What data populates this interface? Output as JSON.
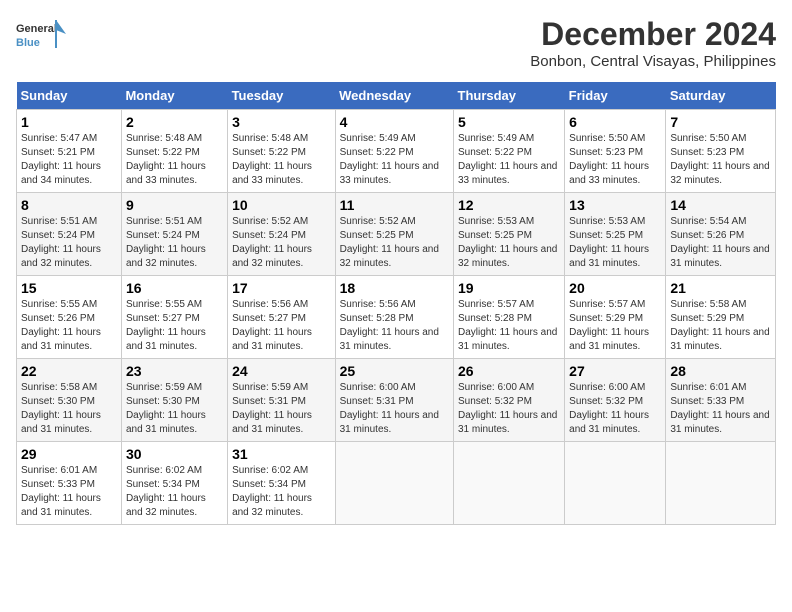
{
  "logo": {
    "line1": "General",
    "line2": "Blue"
  },
  "title": "December 2024",
  "subtitle": "Bonbon, Central Visayas, Philippines",
  "weekdays": [
    "Sunday",
    "Monday",
    "Tuesday",
    "Wednesday",
    "Thursday",
    "Friday",
    "Saturday"
  ],
  "weeks": [
    [
      {
        "day": "1",
        "sunrise": "5:47 AM",
        "sunset": "5:21 PM",
        "daylight": "11 hours and 34 minutes."
      },
      {
        "day": "2",
        "sunrise": "5:48 AM",
        "sunset": "5:22 PM",
        "daylight": "11 hours and 33 minutes."
      },
      {
        "day": "3",
        "sunrise": "5:48 AM",
        "sunset": "5:22 PM",
        "daylight": "11 hours and 33 minutes."
      },
      {
        "day": "4",
        "sunrise": "5:49 AM",
        "sunset": "5:22 PM",
        "daylight": "11 hours and 33 minutes."
      },
      {
        "day": "5",
        "sunrise": "5:49 AM",
        "sunset": "5:22 PM",
        "daylight": "11 hours and 33 minutes."
      },
      {
        "day": "6",
        "sunrise": "5:50 AM",
        "sunset": "5:23 PM",
        "daylight": "11 hours and 33 minutes."
      },
      {
        "day": "7",
        "sunrise": "5:50 AM",
        "sunset": "5:23 PM",
        "daylight": "11 hours and 32 minutes."
      }
    ],
    [
      {
        "day": "8",
        "sunrise": "5:51 AM",
        "sunset": "5:24 PM",
        "daylight": "11 hours and 32 minutes."
      },
      {
        "day": "9",
        "sunrise": "5:51 AM",
        "sunset": "5:24 PM",
        "daylight": "11 hours and 32 minutes."
      },
      {
        "day": "10",
        "sunrise": "5:52 AM",
        "sunset": "5:24 PM",
        "daylight": "11 hours and 32 minutes."
      },
      {
        "day": "11",
        "sunrise": "5:52 AM",
        "sunset": "5:25 PM",
        "daylight": "11 hours and 32 minutes."
      },
      {
        "day": "12",
        "sunrise": "5:53 AM",
        "sunset": "5:25 PM",
        "daylight": "11 hours and 32 minutes."
      },
      {
        "day": "13",
        "sunrise": "5:53 AM",
        "sunset": "5:25 PM",
        "daylight": "11 hours and 31 minutes."
      },
      {
        "day": "14",
        "sunrise": "5:54 AM",
        "sunset": "5:26 PM",
        "daylight": "11 hours and 31 minutes."
      }
    ],
    [
      {
        "day": "15",
        "sunrise": "5:55 AM",
        "sunset": "5:26 PM",
        "daylight": "11 hours and 31 minutes."
      },
      {
        "day": "16",
        "sunrise": "5:55 AM",
        "sunset": "5:27 PM",
        "daylight": "11 hours and 31 minutes."
      },
      {
        "day": "17",
        "sunrise": "5:56 AM",
        "sunset": "5:27 PM",
        "daylight": "11 hours and 31 minutes."
      },
      {
        "day": "18",
        "sunrise": "5:56 AM",
        "sunset": "5:28 PM",
        "daylight": "11 hours and 31 minutes."
      },
      {
        "day": "19",
        "sunrise": "5:57 AM",
        "sunset": "5:28 PM",
        "daylight": "11 hours and 31 minutes."
      },
      {
        "day": "20",
        "sunrise": "5:57 AM",
        "sunset": "5:29 PM",
        "daylight": "11 hours and 31 minutes."
      },
      {
        "day": "21",
        "sunrise": "5:58 AM",
        "sunset": "5:29 PM",
        "daylight": "11 hours and 31 minutes."
      }
    ],
    [
      {
        "day": "22",
        "sunrise": "5:58 AM",
        "sunset": "5:30 PM",
        "daylight": "11 hours and 31 minutes."
      },
      {
        "day": "23",
        "sunrise": "5:59 AM",
        "sunset": "5:30 PM",
        "daylight": "11 hours and 31 minutes."
      },
      {
        "day": "24",
        "sunrise": "5:59 AM",
        "sunset": "5:31 PM",
        "daylight": "11 hours and 31 minutes."
      },
      {
        "day": "25",
        "sunrise": "6:00 AM",
        "sunset": "5:31 PM",
        "daylight": "11 hours and 31 minutes."
      },
      {
        "day": "26",
        "sunrise": "6:00 AM",
        "sunset": "5:32 PM",
        "daylight": "11 hours and 31 minutes."
      },
      {
        "day": "27",
        "sunrise": "6:00 AM",
        "sunset": "5:32 PM",
        "daylight": "11 hours and 31 minutes."
      },
      {
        "day": "28",
        "sunrise": "6:01 AM",
        "sunset": "5:33 PM",
        "daylight": "11 hours and 31 minutes."
      }
    ],
    [
      {
        "day": "29",
        "sunrise": "6:01 AM",
        "sunset": "5:33 PM",
        "daylight": "11 hours and 31 minutes."
      },
      {
        "day": "30",
        "sunrise": "6:02 AM",
        "sunset": "5:34 PM",
        "daylight": "11 hours and 32 minutes."
      },
      {
        "day": "31",
        "sunrise": "6:02 AM",
        "sunset": "5:34 PM",
        "daylight": "11 hours and 32 minutes."
      },
      null,
      null,
      null,
      null
    ]
  ],
  "labels": {
    "sunrise": "Sunrise:",
    "sunset": "Sunset:",
    "daylight": "Daylight:"
  }
}
